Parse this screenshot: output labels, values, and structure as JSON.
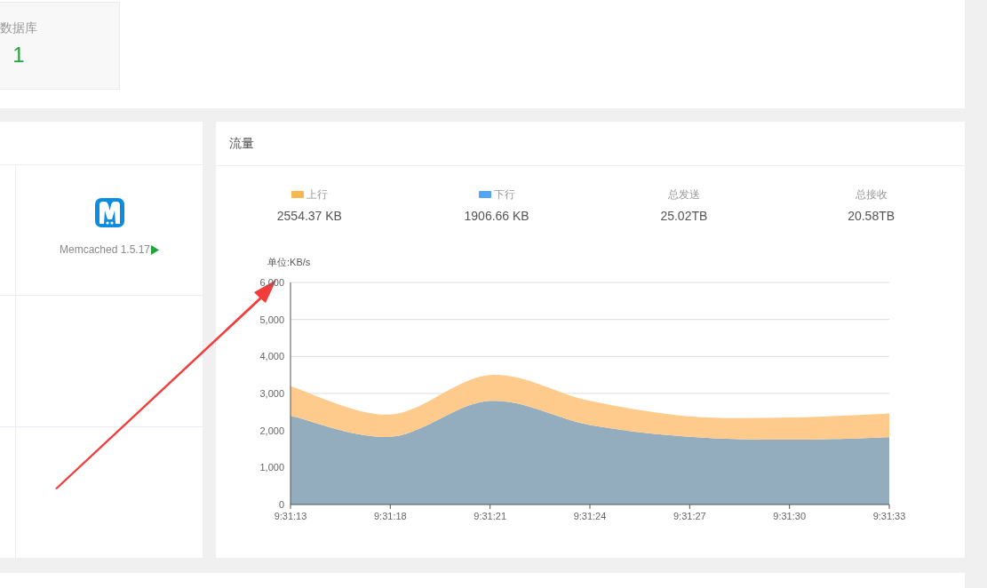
{
  "summary_card": {
    "label": "数据库",
    "value": "1"
  },
  "services_panel": {
    "items": [
      {
        "name": "Memcached 1.5.17",
        "running": true
      }
    ]
  },
  "traffic_panel": {
    "title": "流量",
    "legend": [
      {
        "value": "2554.37 KB",
        "color": "#f7b84f"
      },
      {
        "value": "1906.66 KB",
        "color": "#52a5f7"
      }
    ],
    "stats": [
      {
        "label": "总发送",
        "value": "25.02TB"
      },
      {
        "label": "总接收",
        "value": "20.58TB"
      }
    ],
    "chart_data": {
      "type": "area",
      "stacked": true,
      "grid": true,
      "ylabel": "单位:KB/s",
      "categories": [
        "9:31:13",
        "9:31:18",
        "9:31:21",
        "9:31:24",
        "9:31:27",
        "9:31:30",
        "9:31:33"
      ],
      "series": [
        {
          "name": "上行",
          "color": "#ffcb8c",
          "values": [
            800,
            600,
            700,
            650,
            550,
            600,
            640
          ]
        },
        {
          "name": "下行",
          "color": "#93acbe",
          "values": [
            2400,
            1830,
            2800,
            2150,
            1830,
            1750,
            1820
          ]
        }
      ],
      "ylim": [
        0,
        6000
      ],
      "yticks": [
        0,
        {
          "value": 1000,
          "label": "1,000"
        },
        {
          "value": 2000,
          "label": "2,000"
        },
        {
          "value": 3000,
          "label": "3,000"
        },
        {
          "value": 4000,
          "label": "4,000"
        },
        {
          "value": 5000,
          "label": "5,000"
        },
        {
          "value": 6000,
          "label": "6,000"
        }
      ]
    }
  }
}
